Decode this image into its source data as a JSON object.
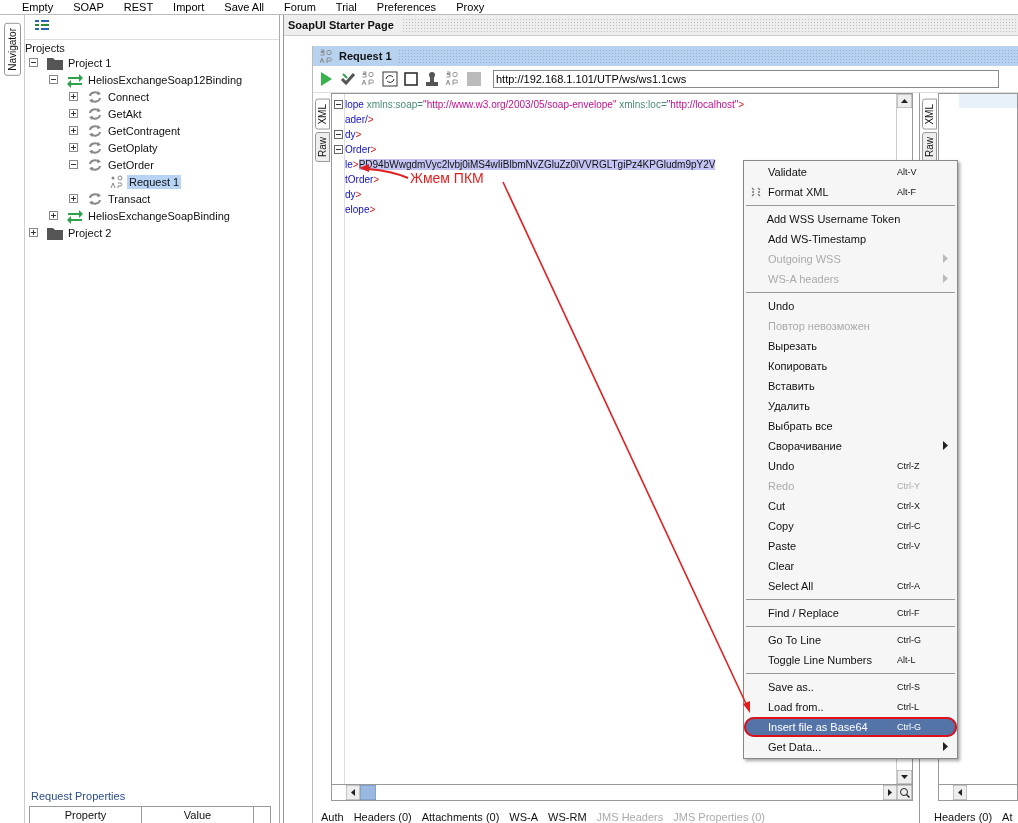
{
  "main_toolbar": {
    "items": [
      "Empty",
      "SOAP",
      "REST",
      "Import",
      "Save All",
      "Forum",
      "Trial",
      "Preferences",
      "Proxy"
    ]
  },
  "navigator_tab": {
    "label": "Navigator"
  },
  "navigator": {
    "root_label": "Projects",
    "tree": [
      {
        "label": "Project 1",
        "kind": "project",
        "expanded": true,
        "selected": false,
        "children": [
          {
            "label": "HeliosExchangeSoap12Binding",
            "kind": "binding",
            "expanded": true,
            "selected": false,
            "children": [
              {
                "label": "Connect",
                "kind": "operation",
                "expanded": false,
                "selected": false
              },
              {
                "label": "GetAkt",
                "kind": "operation",
                "expanded": false,
                "selected": false
              },
              {
                "label": "GetContragent",
                "kind": "operation",
                "expanded": false,
                "selected": false
              },
              {
                "label": "GetOplaty",
                "kind": "operation",
                "expanded": false,
                "selected": false
              },
              {
                "label": "GetOrder",
                "kind": "operation",
                "expanded": true,
                "selected": false,
                "children": [
                  {
                    "label": "Request 1",
                    "kind": "request",
                    "selected": true
                  }
                ]
              },
              {
                "label": "Transact",
                "kind": "operation",
                "expanded": false,
                "selected": false
              }
            ]
          },
          {
            "label": "HeliosExchangeSoapBinding",
            "kind": "binding",
            "expanded": false,
            "selected": false
          }
        ]
      },
      {
        "label": "Project 2",
        "kind": "project",
        "expanded": false,
        "selected": false
      }
    ],
    "properties_title": "Request Properties",
    "properties_columns": [
      "Property",
      "Value"
    ]
  },
  "starter_tab": {
    "title": "SoapUI Starter Page"
  },
  "request_window": {
    "title": "Request 1",
    "url": "http://192.168.1.101/UTP/ws/ws1.1cws",
    "editor_tabs": [
      {
        "label": "XML",
        "selected": true
      },
      {
        "label": "Raw",
        "selected": false
      }
    ],
    "lines": [
      {
        "fold": true,
        "tokens": [
          {
            "kind": "tag",
            "text": "lope"
          },
          {
            "kind": "attr",
            "text": " xmlns:soap="
          },
          {
            "kind": "value",
            "text": "\"http://www.w3.org/2003/05/soap-envelope\""
          },
          {
            "kind": "attr",
            "text": " xmlns:loc="
          },
          {
            "kind": "value",
            "text": "\"http://localhost\""
          },
          {
            "kind": "punct",
            "text": ">"
          }
        ]
      },
      {
        "fold": false,
        "tokens": [
          {
            "kind": "tag",
            "text": "ader/"
          },
          {
            "kind": "punct",
            "text": ">"
          }
        ]
      },
      {
        "fold": true,
        "tokens": [
          {
            "kind": "tag",
            "text": "dy"
          },
          {
            "kind": "punct",
            "text": ">"
          }
        ]
      },
      {
        "fold": true,
        "tokens": [
          {
            "kind": "tag",
            "text": "Order"
          },
          {
            "kind": "punct",
            "text": ">"
          }
        ]
      },
      {
        "fold": false,
        "tokens": [
          {
            "kind": "tag",
            "text": "le"
          },
          {
            "kind": "punct",
            "text": ">"
          },
          {
            "kind": "selected_text",
            "text": "PD94bWwgdmVyc2lvbj0iMS4wIiBlbmNvZGluZz0iVVRGLTgiPz4KPGludm9pY2V"
          }
        ]
      },
      {
        "fold": false,
        "tokens": [
          {
            "kind": "tag",
            "text": "tOrder"
          },
          {
            "kind": "punct",
            "text": ">"
          }
        ]
      },
      {
        "fold": false,
        "tokens": [
          {
            "kind": "tag",
            "text": "dy"
          },
          {
            "kind": "punct",
            "text": ">"
          }
        ]
      },
      {
        "fold": false,
        "tokens": [
          {
            "kind": "tag",
            "text": "elope"
          },
          {
            "kind": "punct",
            "text": ">"
          }
        ]
      }
    ],
    "bottom_tabs": [
      {
        "label": "Auth",
        "disabled": false
      },
      {
        "label": "Headers (0)",
        "disabled": false
      },
      {
        "label": "Attachments (0)",
        "disabled": false
      },
      {
        "label": "WS-A",
        "disabled": false
      },
      {
        "label": "WS-RM",
        "disabled": false
      },
      {
        "label": "JMS Headers",
        "disabled": true
      },
      {
        "label": "JMS Properties (0)",
        "disabled": true
      }
    ],
    "response_tabs": [
      {
        "label": "XML",
        "selected": true
      },
      {
        "label": "Raw",
        "selected": false
      }
    ],
    "response_bottom_tabs": [
      "Headers (0)",
      "At"
    ]
  },
  "context_menu": {
    "items": [
      {
        "kind": "item",
        "label": "Validate",
        "shortcut": "Alt-V",
        "disabled": false,
        "submenu": false,
        "selected": false
      },
      {
        "kind": "icon_item",
        "label": "Format XML",
        "shortcut": "Alt-F",
        "disabled": false,
        "submenu": false,
        "selected": false
      },
      {
        "kind": "separator"
      },
      {
        "kind": "item",
        "label": "Add WSS Username Token",
        "disabled": false,
        "submenu": false,
        "selected": false
      },
      {
        "kind": "item",
        "label": "Add WS-Timestamp",
        "disabled": false,
        "submenu": false,
        "selected": false
      },
      {
        "kind": "item",
        "label": "Outgoing WSS",
        "disabled": true,
        "submenu": true,
        "selected": false
      },
      {
        "kind": "item",
        "label": "WS-A headers",
        "disabled": true,
        "submenu": true,
        "selected": false
      },
      {
        "kind": "separator"
      },
      {
        "kind": "item",
        "label": "Undo",
        "disabled": false,
        "submenu": false,
        "selected": false
      },
      {
        "kind": "item",
        "label": "Повтор невозможен",
        "disabled": true,
        "submenu": false,
        "selected": false
      },
      {
        "kind": "item",
        "label": "Вырезать",
        "disabled": false,
        "submenu": false,
        "selected": false
      },
      {
        "kind": "item",
        "label": "Копировать",
        "disabled": false,
        "submenu": false,
        "selected": false
      },
      {
        "kind": "item",
        "label": "Вставить",
        "disabled": false,
        "submenu": false,
        "selected": false
      },
      {
        "kind": "item",
        "label": "Удалить",
        "disabled": false,
        "submenu": false,
        "selected": false
      },
      {
        "kind": "item",
        "label": "Выбрать все",
        "disabled": false,
        "submenu": false,
        "selected": false
      },
      {
        "kind": "item",
        "label": "Сворачивание",
        "disabled": false,
        "submenu": true,
        "selected": false
      },
      {
        "kind": "item",
        "label": "Undo",
        "shortcut": "Ctrl-Z",
        "disabled": false,
        "submenu": false,
        "selected": false
      },
      {
        "kind": "item",
        "label": "Redo",
        "shortcut": "Ctrl-Y",
        "disabled": true,
        "submenu": false,
        "selected": false
      },
      {
        "kind": "item",
        "label": "Cut",
        "shortcut": "Ctrl-X",
        "disabled": false,
        "submenu": false,
        "selected": false
      },
      {
        "kind": "item",
        "label": "Copy",
        "shortcut": "Ctrl-C",
        "disabled": false,
        "submenu": false,
        "selected": false
      },
      {
        "kind": "item",
        "label": "Paste",
        "shortcut": "Ctrl-V",
        "disabled": false,
        "submenu": false,
        "selected": false
      },
      {
        "kind": "item",
        "label": "Clear",
        "disabled": false,
        "submenu": false,
        "selected": false
      },
      {
        "kind": "item",
        "label": "Select All",
        "shortcut": "Ctrl-A",
        "disabled": false,
        "submenu": false,
        "selected": false
      },
      {
        "kind": "separator"
      },
      {
        "kind": "item",
        "label": "Find / Replace",
        "shortcut": "Ctrl-F",
        "disabled": false,
        "submenu": false,
        "selected": false
      },
      {
        "kind": "separator"
      },
      {
        "kind": "item",
        "label": "Go To Line",
        "shortcut": "Ctrl-G",
        "disabled": false,
        "submenu": false,
        "selected": false
      },
      {
        "kind": "item",
        "label": "Toggle Line Numbers",
        "shortcut": "Alt-L",
        "disabled": false,
        "submenu": false,
        "selected": false
      },
      {
        "kind": "separator"
      },
      {
        "kind": "item",
        "label": "Save as..",
        "shortcut": "Ctrl-S",
        "disabled": false,
        "submenu": false,
        "selected": false
      },
      {
        "kind": "item",
        "label": "Load from..",
        "shortcut": "Ctrl-L",
        "disabled": false,
        "submenu": false,
        "selected": false
      },
      {
        "kind": "item",
        "label": "Insert file as Base64",
        "shortcut": "Ctrl-G",
        "disabled": false,
        "submenu": false,
        "selected": true,
        "circled": true
      },
      {
        "kind": "item",
        "label": "Get Data...",
        "disabled": false,
        "submenu": true,
        "selected": false
      }
    ]
  },
  "annotation": {
    "text": "Жмем ПКМ"
  }
}
